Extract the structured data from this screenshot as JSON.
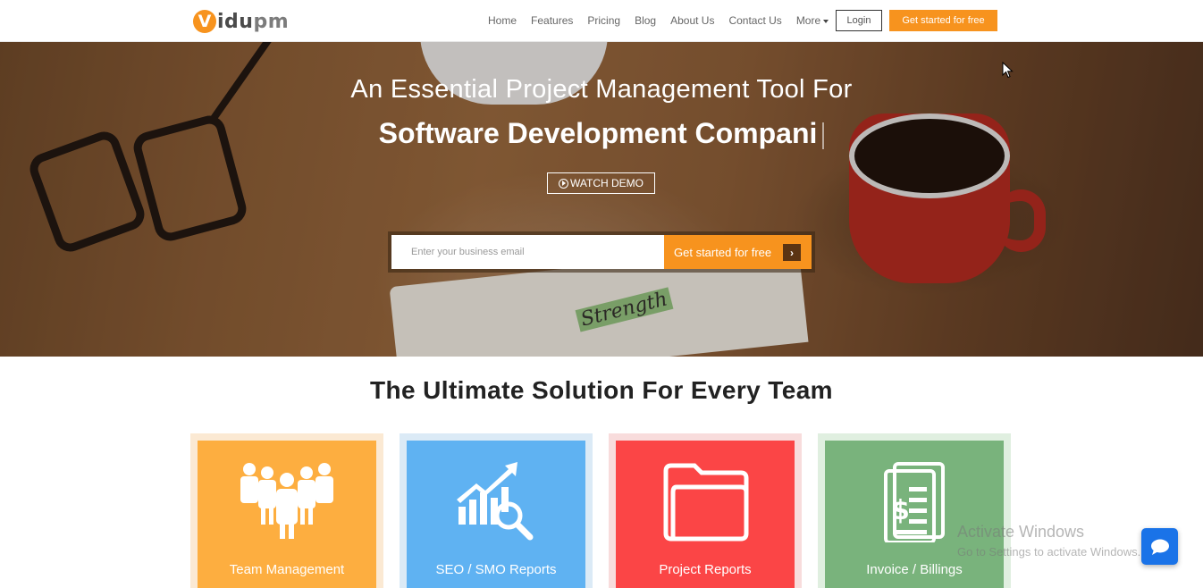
{
  "brand": {
    "logo_initial": "V",
    "logo_name_dark": "idu",
    "logo_name_light": "pm"
  },
  "nav": {
    "items": [
      {
        "label": "Home"
      },
      {
        "label": "Features"
      },
      {
        "label": "Pricing"
      },
      {
        "label": "Blog"
      },
      {
        "label": "About Us"
      },
      {
        "label": "Contact Us"
      },
      {
        "label": "More"
      }
    ],
    "login_label": "Login",
    "cta_label": "Get started for free"
  },
  "hero": {
    "title": "An Essential Project Management Tool For",
    "subtitle": "Software Development Compani",
    "demo_label": "WATCH DEMO",
    "email_placeholder": "Enter your business email",
    "cta_label": "Get started for free",
    "handwritten_word": "Strength"
  },
  "section": {
    "title": "The Ultimate Solution For Every Team",
    "cards": [
      {
        "label": "Team Management",
        "icon": "team-icon",
        "color": "#fdae40",
        "frame": "#fbe9d3"
      },
      {
        "label": "SEO / SMO Reports",
        "icon": "chart-search-icon",
        "color": "#5fb2f2",
        "frame": "#dbeaf6"
      },
      {
        "label": "Project Reports",
        "icon": "folder-icon",
        "color": "#fb4546",
        "frame": "#f8dcdc"
      },
      {
        "label": "Invoice / Billings",
        "icon": "invoice-icon",
        "color": "#79b37c",
        "frame": "#e0efe0"
      }
    ]
  },
  "overlay": {
    "activate_title": "Activate Windows",
    "activate_sub": "Go to Settings to activate Windows."
  },
  "colors": {
    "accent": "#f7931e",
    "chat": "#1a73e8"
  }
}
